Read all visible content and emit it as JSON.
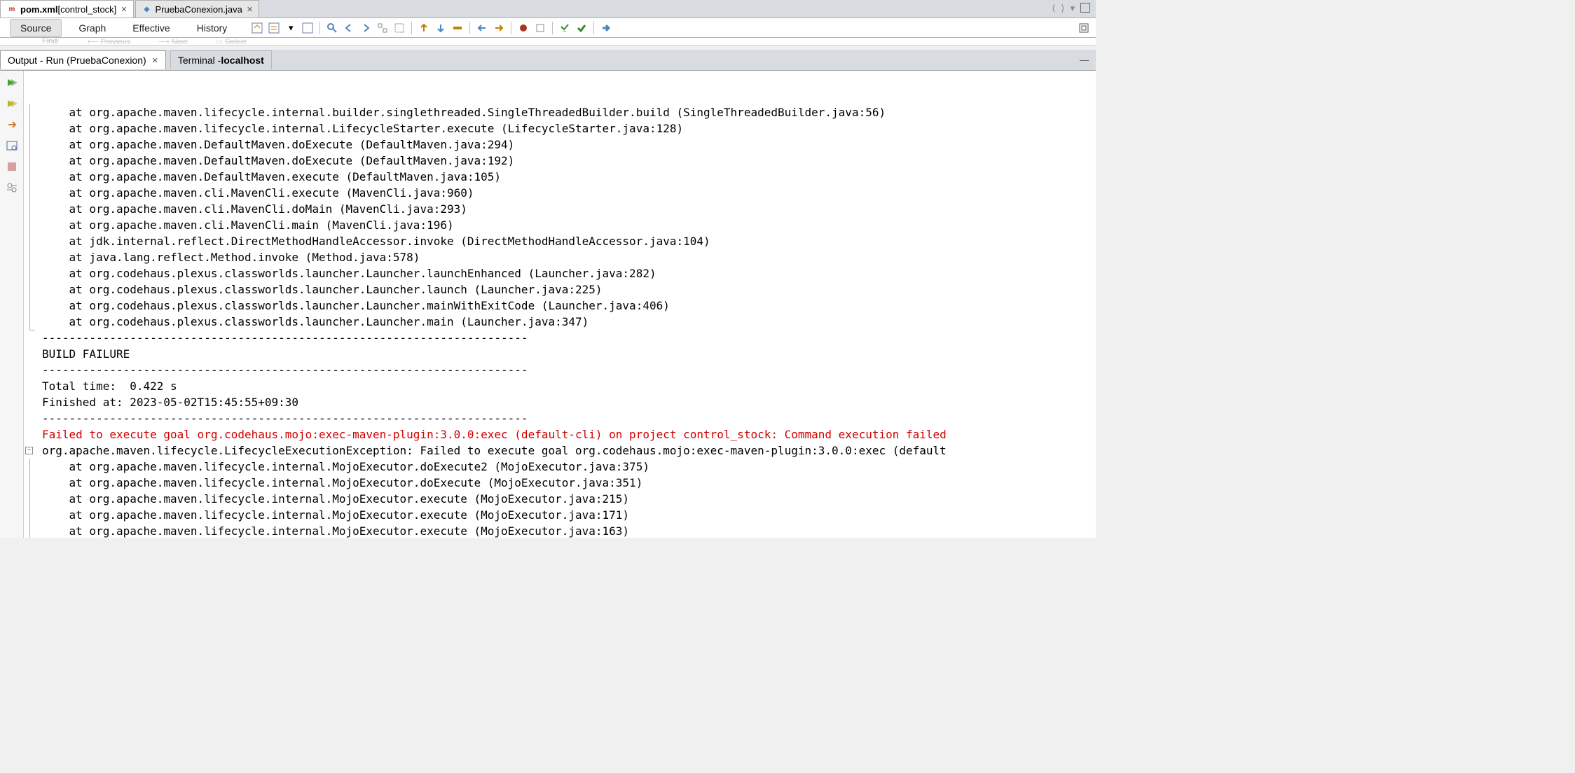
{
  "editor_tabs": {
    "tab1": {
      "label_bold": "pom.xml",
      "label_suffix": " [control_stock]"
    },
    "tab2": {
      "label": "PruebaConexion.java"
    }
  },
  "subtabs": {
    "source": "Source",
    "graph": "Graph",
    "effective": "Effective",
    "history": "History"
  },
  "findbar": {
    "find_label": "Find:",
    "previous": "Previous",
    "next": "Next",
    "select": "Select"
  },
  "output_tabs": {
    "active": "Output - Run (PruebaConexion)",
    "terminal_prefix": "Terminal - ",
    "terminal_host": "localhost"
  },
  "console_lines": [
    "    at org.apache.maven.lifecycle.internal.builder.singlethreaded.SingleThreadedBuilder.build (SingleThreadedBuilder.java:56)",
    "    at org.apache.maven.lifecycle.internal.LifecycleStarter.execute (LifecycleStarter.java:128)",
    "    at org.apache.maven.DefaultMaven.doExecute (DefaultMaven.java:294)",
    "    at org.apache.maven.DefaultMaven.doExecute (DefaultMaven.java:192)",
    "    at org.apache.maven.DefaultMaven.execute (DefaultMaven.java:105)",
    "    at org.apache.maven.cli.MavenCli.execute (MavenCli.java:960)",
    "    at org.apache.maven.cli.MavenCli.doMain (MavenCli.java:293)",
    "    at org.apache.maven.cli.MavenCli.main (MavenCli.java:196)",
    "    at jdk.internal.reflect.DirectMethodHandleAccessor.invoke (DirectMethodHandleAccessor.java:104)",
    "    at java.lang.reflect.Method.invoke (Method.java:578)",
    "    at org.codehaus.plexus.classworlds.launcher.Launcher.launchEnhanced (Launcher.java:282)",
    "    at org.codehaus.plexus.classworlds.launcher.Launcher.launch (Launcher.java:225)",
    "    at org.codehaus.plexus.classworlds.launcher.Launcher.mainWithExitCode (Launcher.java:406)",
    "    at org.codehaus.plexus.classworlds.launcher.Launcher.main (Launcher.java:347)"
  ],
  "separator_line": "------------------------------------------------------------------------",
  "build_status": "BUILD FAILURE",
  "total_time": "Total time:  0.422 s",
  "finished_at": "Finished at: 2023-05-02T15:45:55+09:30",
  "error_line": "Failed to execute goal org.codehaus.mojo:exec-maven-plugin:3.0.0:exec (default-cli) on project control_stock: Command execution failed",
  "exception_line": "org.apache.maven.lifecycle.LifecycleExecutionException: Failed to execute goal org.codehaus.mojo:exec-maven-plugin:3.0.0:exec (default",
  "trace2": [
    "    at org.apache.maven.lifecycle.internal.MojoExecutor.doExecute2 (MojoExecutor.java:375)",
    "    at org.apache.maven.lifecycle.internal.MojoExecutor.doExecute (MojoExecutor.java:351)",
    "    at org.apache.maven.lifecycle.internal.MojoExecutor.execute (MojoExecutor.java:215)",
    "    at org.apache.maven.lifecycle.internal.MojoExecutor.execute (MojoExecutor.java:171)",
    "    at org.apache.maven.lifecycle.internal.MojoExecutor.execute (MojoExecutor.java:163)"
  ],
  "colors": {
    "error": "#d00000"
  }
}
